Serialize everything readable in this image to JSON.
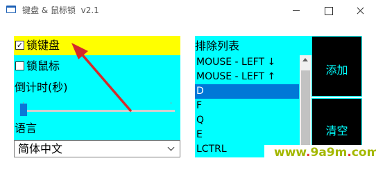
{
  "window": {
    "title": "键盘 & 鼠标锁  v2.1"
  },
  "left": {
    "lock_keyboard_label": "锁键盘",
    "lock_keyboard_checked": true,
    "lock_mouse_label": "锁鼠标",
    "lock_mouse_checked": false,
    "countdown_label": "倒计时(秒)",
    "slider_value": 0,
    "language_label": "语言",
    "language_value": "简体中文",
    "checkbox_mark": "✓"
  },
  "exclusion": {
    "label": "排除列表",
    "items": [
      "MOUSE - LEFT ↓",
      "MOUSE - LEFT ↑",
      "D",
      "F",
      "Q",
      "E",
      "LCTRL"
    ],
    "selected_index": 2
  },
  "buttons": {
    "add_label": "添加",
    "clear_label": "清空"
  },
  "watermark": {
    "text_pre": "www",
    "dot": ".",
    "text_mid": "9a9m",
    "text_post": "com"
  },
  "colors": {
    "panel": "#00ffff",
    "highlight_row": "#ffff00",
    "selected_item": "#0078d7",
    "button_bg": "#000000",
    "button_text": "#00ffff",
    "annotation_arrow": "#d42a2a"
  }
}
